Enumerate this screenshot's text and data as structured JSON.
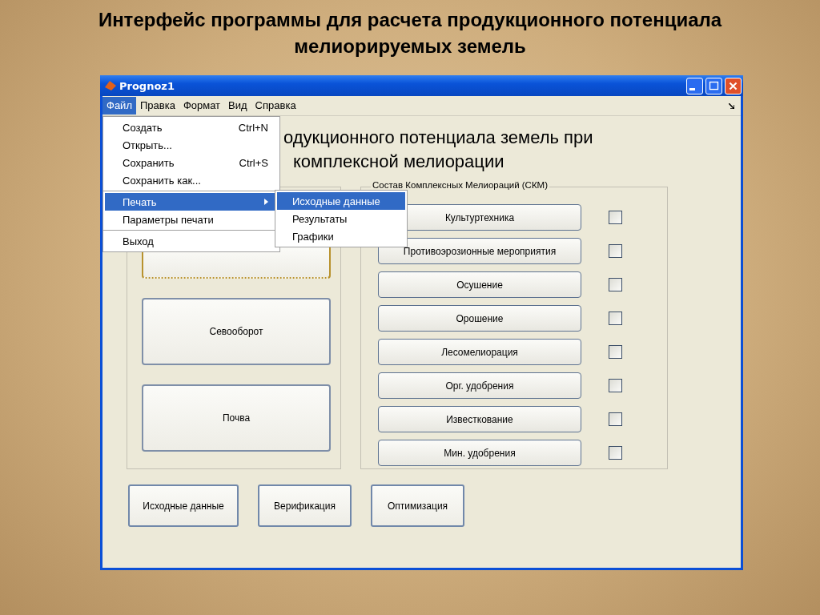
{
  "slide_title": [
    "Интерфейс программы для расчета продукционного потенциала",
    "мелиорируемых земель"
  ],
  "window": {
    "title": "Prognoz1"
  },
  "menu_bar": [
    {
      "label": "Файл",
      "selected": true
    },
    {
      "label": "Правка",
      "selected": false
    },
    {
      "label": "Формат",
      "selected": false
    },
    {
      "label": "Вид",
      "selected": false
    },
    {
      "label": "Справка",
      "selected": false
    }
  ],
  "file_menu": [
    {
      "kind": "item",
      "label": "Создать",
      "shortcut": "Ctrl+N",
      "selected": false
    },
    {
      "kind": "item",
      "label": "Открыть...",
      "selected": false
    },
    {
      "kind": "item",
      "label": "Сохранить",
      "shortcut": "Ctrl+S",
      "selected": false
    },
    {
      "kind": "item",
      "label": "Сохранить как...",
      "selected": false
    },
    {
      "kind": "separator"
    },
    {
      "kind": "submenu",
      "label": "Печать",
      "selected": true
    },
    {
      "kind": "item",
      "label": "Параметры печати",
      "selected": false
    },
    {
      "kind": "separator"
    },
    {
      "kind": "item",
      "label": "Выход",
      "selected": false
    }
  ],
  "print_submenu": [
    {
      "label": "Исходные данные",
      "selected": true
    },
    {
      "label": "Результаты",
      "selected": false
    },
    {
      "label": "Графики",
      "selected": false
    }
  ],
  "heading_lines": [
    "одукционного потенциала земель при",
    "комплексной мелиорации"
  ],
  "left_panel": {
    "buttons": [
      {
        "label": "Севооборот"
      },
      {
        "label": "Почва"
      }
    ]
  },
  "skm_panel": {
    "legend": "Состав Комплексных Мелиораций (СКМ)",
    "rows": [
      {
        "label": "Культуртехника",
        "checked": false
      },
      {
        "label": "Противоэрозионные мероприятия",
        "checked": false
      },
      {
        "label": "Осушение",
        "checked": false
      },
      {
        "label": "Орошение",
        "checked": false
      },
      {
        "label": "Лесомелиорация",
        "checked": false
      },
      {
        "label": "Орг. удобрения",
        "checked": false
      },
      {
        "label": "Известкование",
        "checked": false
      },
      {
        "label": "Мин. удобрения",
        "checked": false
      }
    ]
  },
  "bottom_buttons": [
    {
      "label": "Исходные данные"
    },
    {
      "label": "Верификация"
    },
    {
      "label": "Оптимизация"
    }
  ]
}
